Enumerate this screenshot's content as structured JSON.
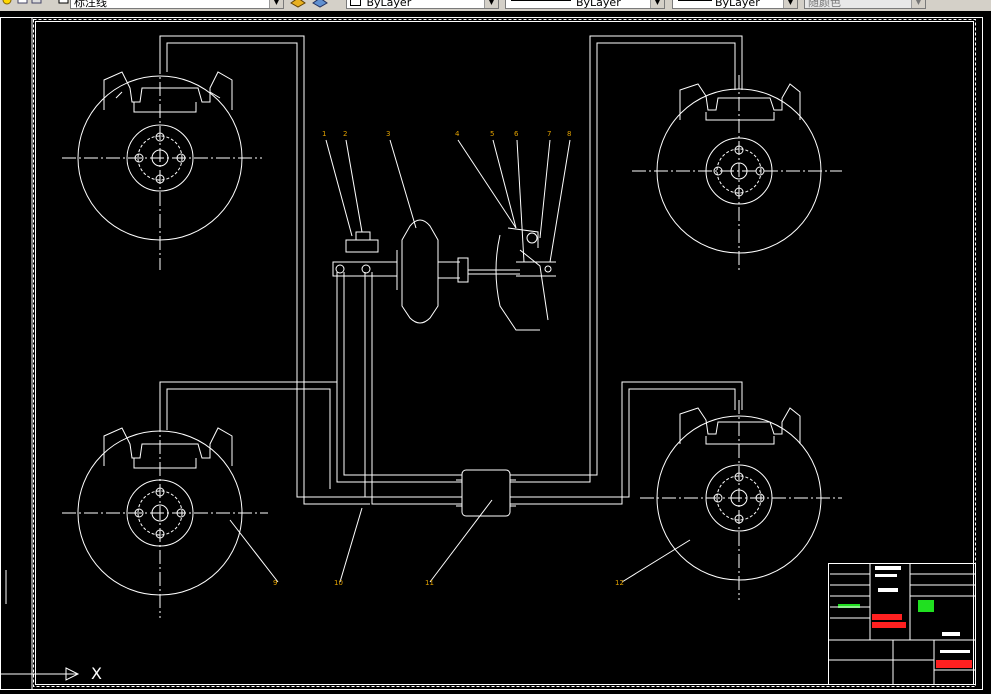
{
  "toolbar": {
    "layer_name": "标注线",
    "color_control": "ByLayer",
    "linetype_control": "ByLayer",
    "lineweight_control": "ByLayer",
    "plotstyle_control": "随颜色"
  },
  "drawing": {
    "part_labels": [
      "1",
      "2",
      "3",
      "4",
      "5",
      "6",
      "7",
      "8",
      "9",
      "10",
      "11",
      "12"
    ],
    "ucs_axis_label": "X"
  },
  "colors": {
    "background": "#000000",
    "lines": "#ffffff",
    "leader_labels": "#e0a000",
    "title_block_red": "#ff2020",
    "title_block_green": "#20e020"
  }
}
